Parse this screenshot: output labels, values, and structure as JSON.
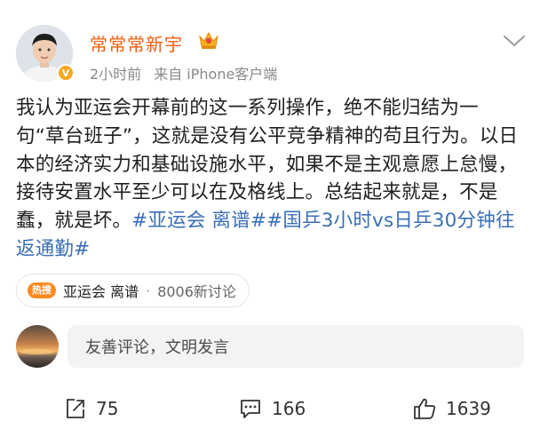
{
  "author": {
    "name": "常常常新宇",
    "time": "2小时前",
    "source_prefix": "来自",
    "source_client": "iPhone客户端"
  },
  "post": {
    "text": "我认为亚运会开幕前的这一系列操作，绝不能归结为一句“草台班子”，这就是没有公平竞争精神的苟且行为。以日本的经济实力和基础设施水平，如果不是主观意愿上怠慢，接待安置水平至少可以在及格线上。总结起来就是，不是蠢，就是坏。",
    "hashtags": "#亚运会 离谱##国乒3小时vs日乒30分钟往返通勤#"
  },
  "topic": {
    "badge": "热搜",
    "name": "亚运会 离谱",
    "separator": "·",
    "discussion": "8006新讨论"
  },
  "comment": {
    "placeholder": "友善评论，文明发言"
  },
  "actions": {
    "repost": "75",
    "comments": "166",
    "likes": "1639"
  },
  "colors": {
    "username": "#f25c0c",
    "hashtag": "#3b6fb6",
    "hot_badge": "#ff8a1f",
    "verified": "#f7a71d"
  },
  "icons": [
    "avatar",
    "verified-icon",
    "crown-icon",
    "chevron-down-icon",
    "repost-icon",
    "comment-icon",
    "like-icon"
  ]
}
